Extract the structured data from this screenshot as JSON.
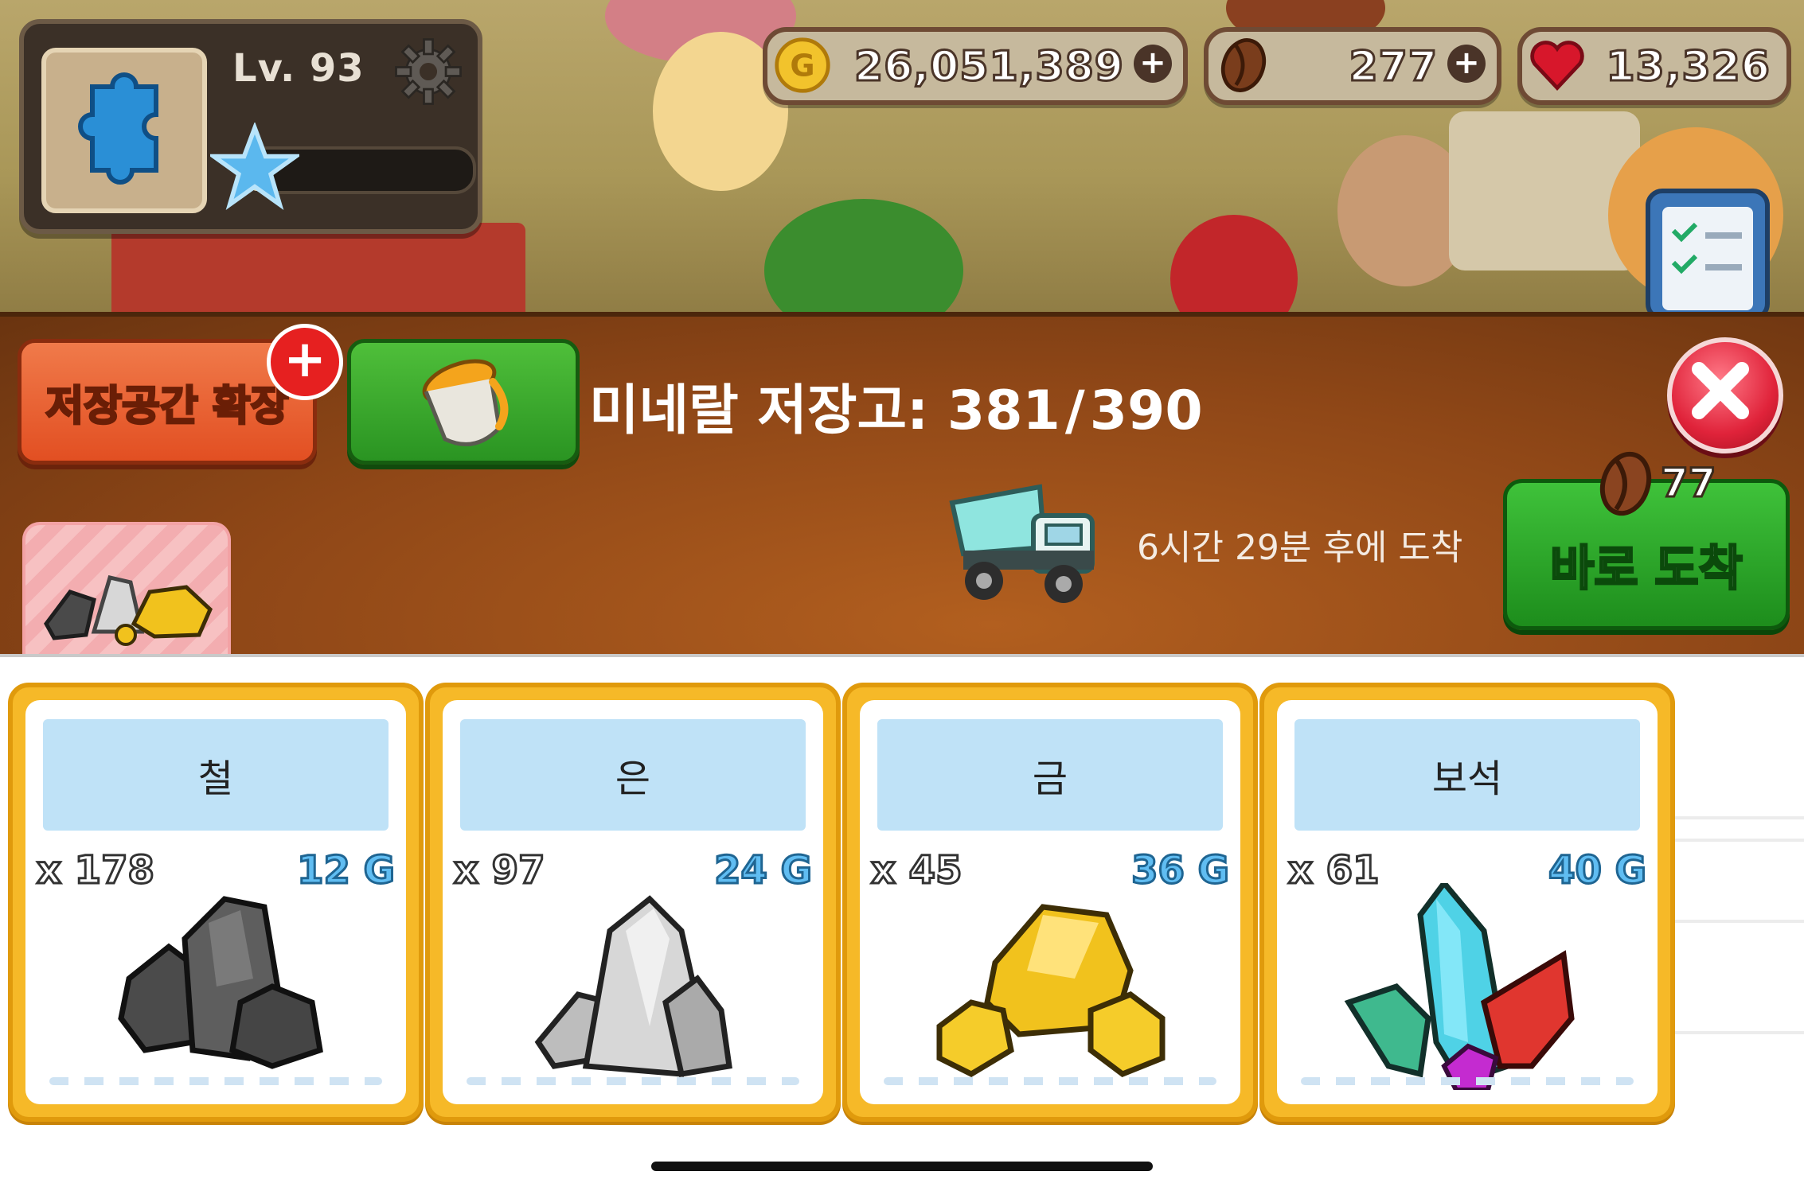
{
  "hud": {
    "level": "Lv. 93",
    "xp_progress": 0.06,
    "gold": "26,051,389",
    "beans": "277",
    "hearts": "13,326"
  },
  "panel": {
    "expand_label": "저장공간 확장",
    "storage_label": "미네랄 저장고:",
    "storage_used": "381",
    "storage_sep": "/",
    "storage_max": "390",
    "arrival_text": "6시간 29분 후에 도착",
    "instant_label": "바로 도착",
    "instant_cost": "77"
  },
  "items": [
    {
      "name": "철",
      "qty": "x 178",
      "price": "12 G",
      "icon": "iron-ore-icon"
    },
    {
      "name": "은",
      "qty": "x 97",
      "price": "24 G",
      "icon": "silver-ore-icon"
    },
    {
      "name": "금",
      "qty": "x 45",
      "price": "36 G",
      "icon": "gold-ore-icon"
    },
    {
      "name": "보석",
      "qty": "x 61",
      "price": "40 G",
      "icon": "gem-icon"
    }
  ],
  "colors": {
    "panel_brown": "#8f4717",
    "card_border": "#f6b928",
    "name_bg": "#bfe2f7",
    "price_blue": "#60bdf2",
    "close_red": "#e0233a",
    "green_button": "#2a9422"
  }
}
